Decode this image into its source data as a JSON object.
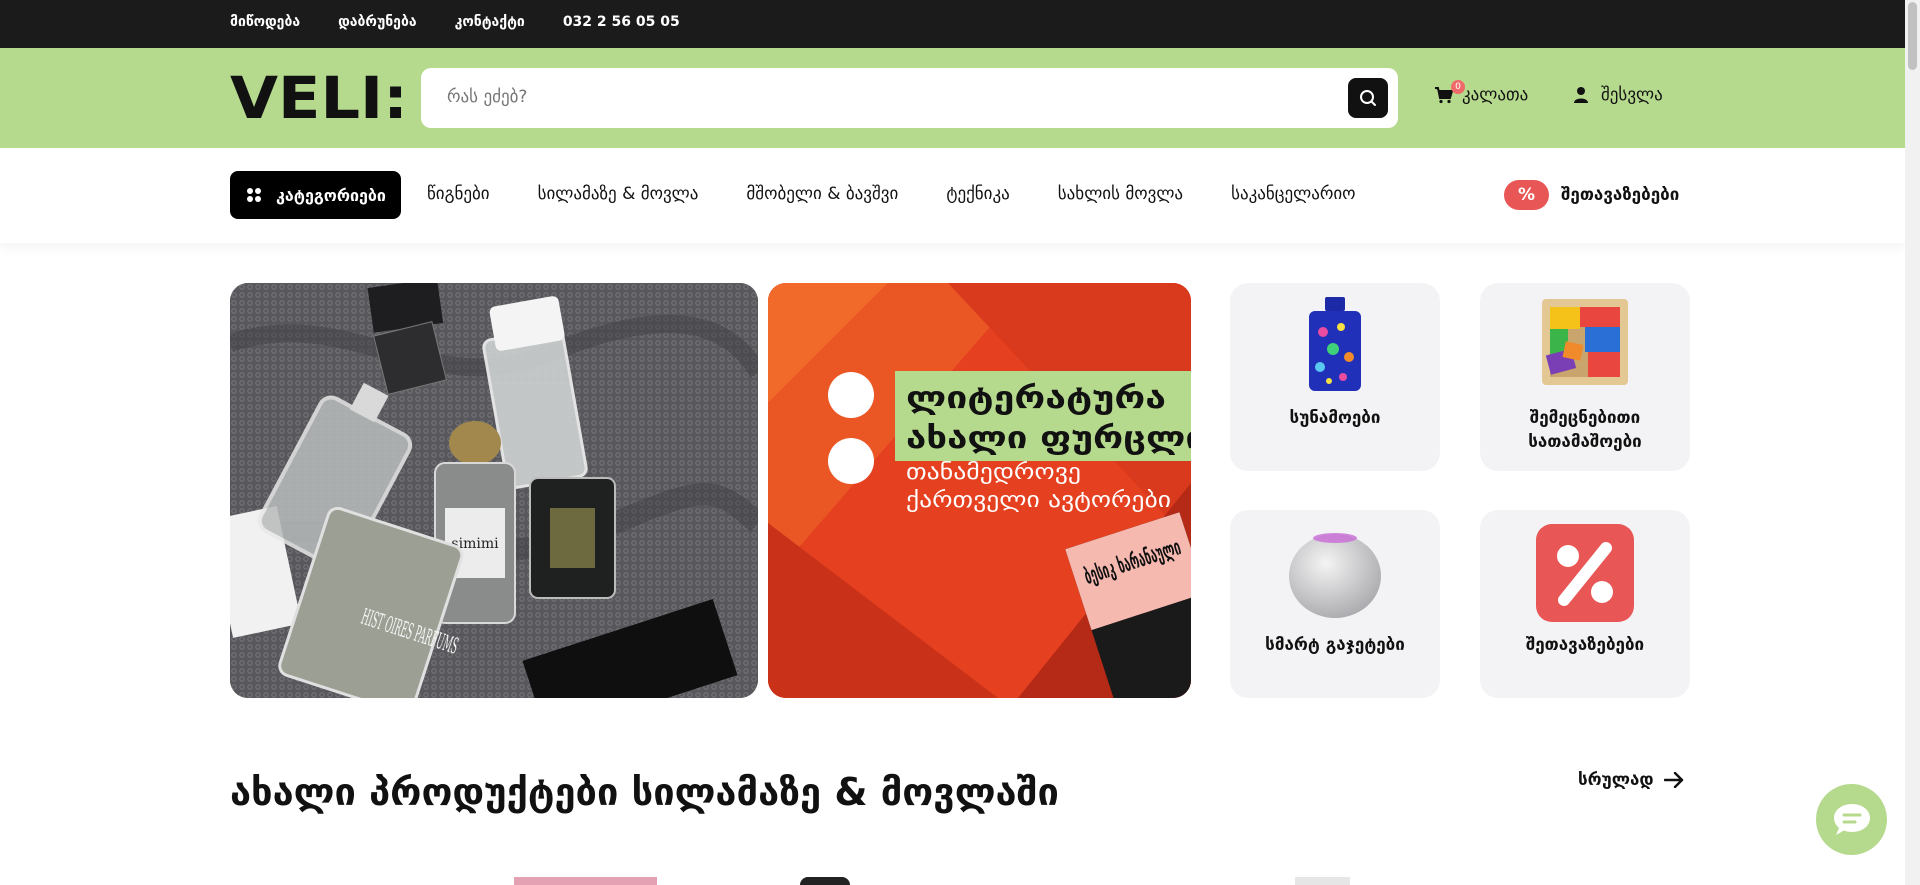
{
  "topbar": {
    "links": [
      "მიწოდება",
      "დაბრუნება",
      "კონტაქტი",
      "032 2 56 05 05"
    ]
  },
  "header": {
    "logo_text": "VELI:",
    "search_placeholder": "რას ეძებ?",
    "cart_label": "კალათა",
    "cart_count": "0",
    "login_label": "შესვლა"
  },
  "nav": {
    "categories_label": "კატეგორიები",
    "items": [
      "წიგნები",
      "სილამაზე & მოვლა",
      "მშობელი & ბავშვი",
      "ტექნიკა",
      "სახლის მოვლა",
      "საკანცელარიო"
    ],
    "offers_badge": "%",
    "offers_label": "შეთავაზებები"
  },
  "banners": {
    "perfume": {
      "bottle_labels": [
        "HIST OIRES PARFUMS",
        "simimi"
      ]
    },
    "literature": {
      "headline_1": "ლიტერატურა",
      "headline_2": "ახალი ფურცლი",
      "sub_1": "თანამედროვე",
      "sub_2": "ქართველი ავტორები",
      "book_text": "ბესიკ ხარანაული"
    }
  },
  "tiles": [
    {
      "label": "სუნამოები",
      "icon": "perfume-bottle-icon"
    },
    {
      "label": "შემეცნებითი სათამაშოები",
      "icon": "puzzle-toy-icon"
    },
    {
      "label": "სმარტ გაჯეტები",
      "icon": "smart-speaker-icon"
    },
    {
      "label": "შეთავაზებები",
      "icon": "percent-icon"
    }
  ],
  "section": {
    "title": "ახალი პროდუქტები სილამაზე & მოვლაში",
    "see_all": "სრულად"
  },
  "colors": {
    "topbar": "#1b1b1b",
    "header": "#b6da8d",
    "accent_red": "#e95656",
    "tile_bg": "#f3f3f5"
  }
}
